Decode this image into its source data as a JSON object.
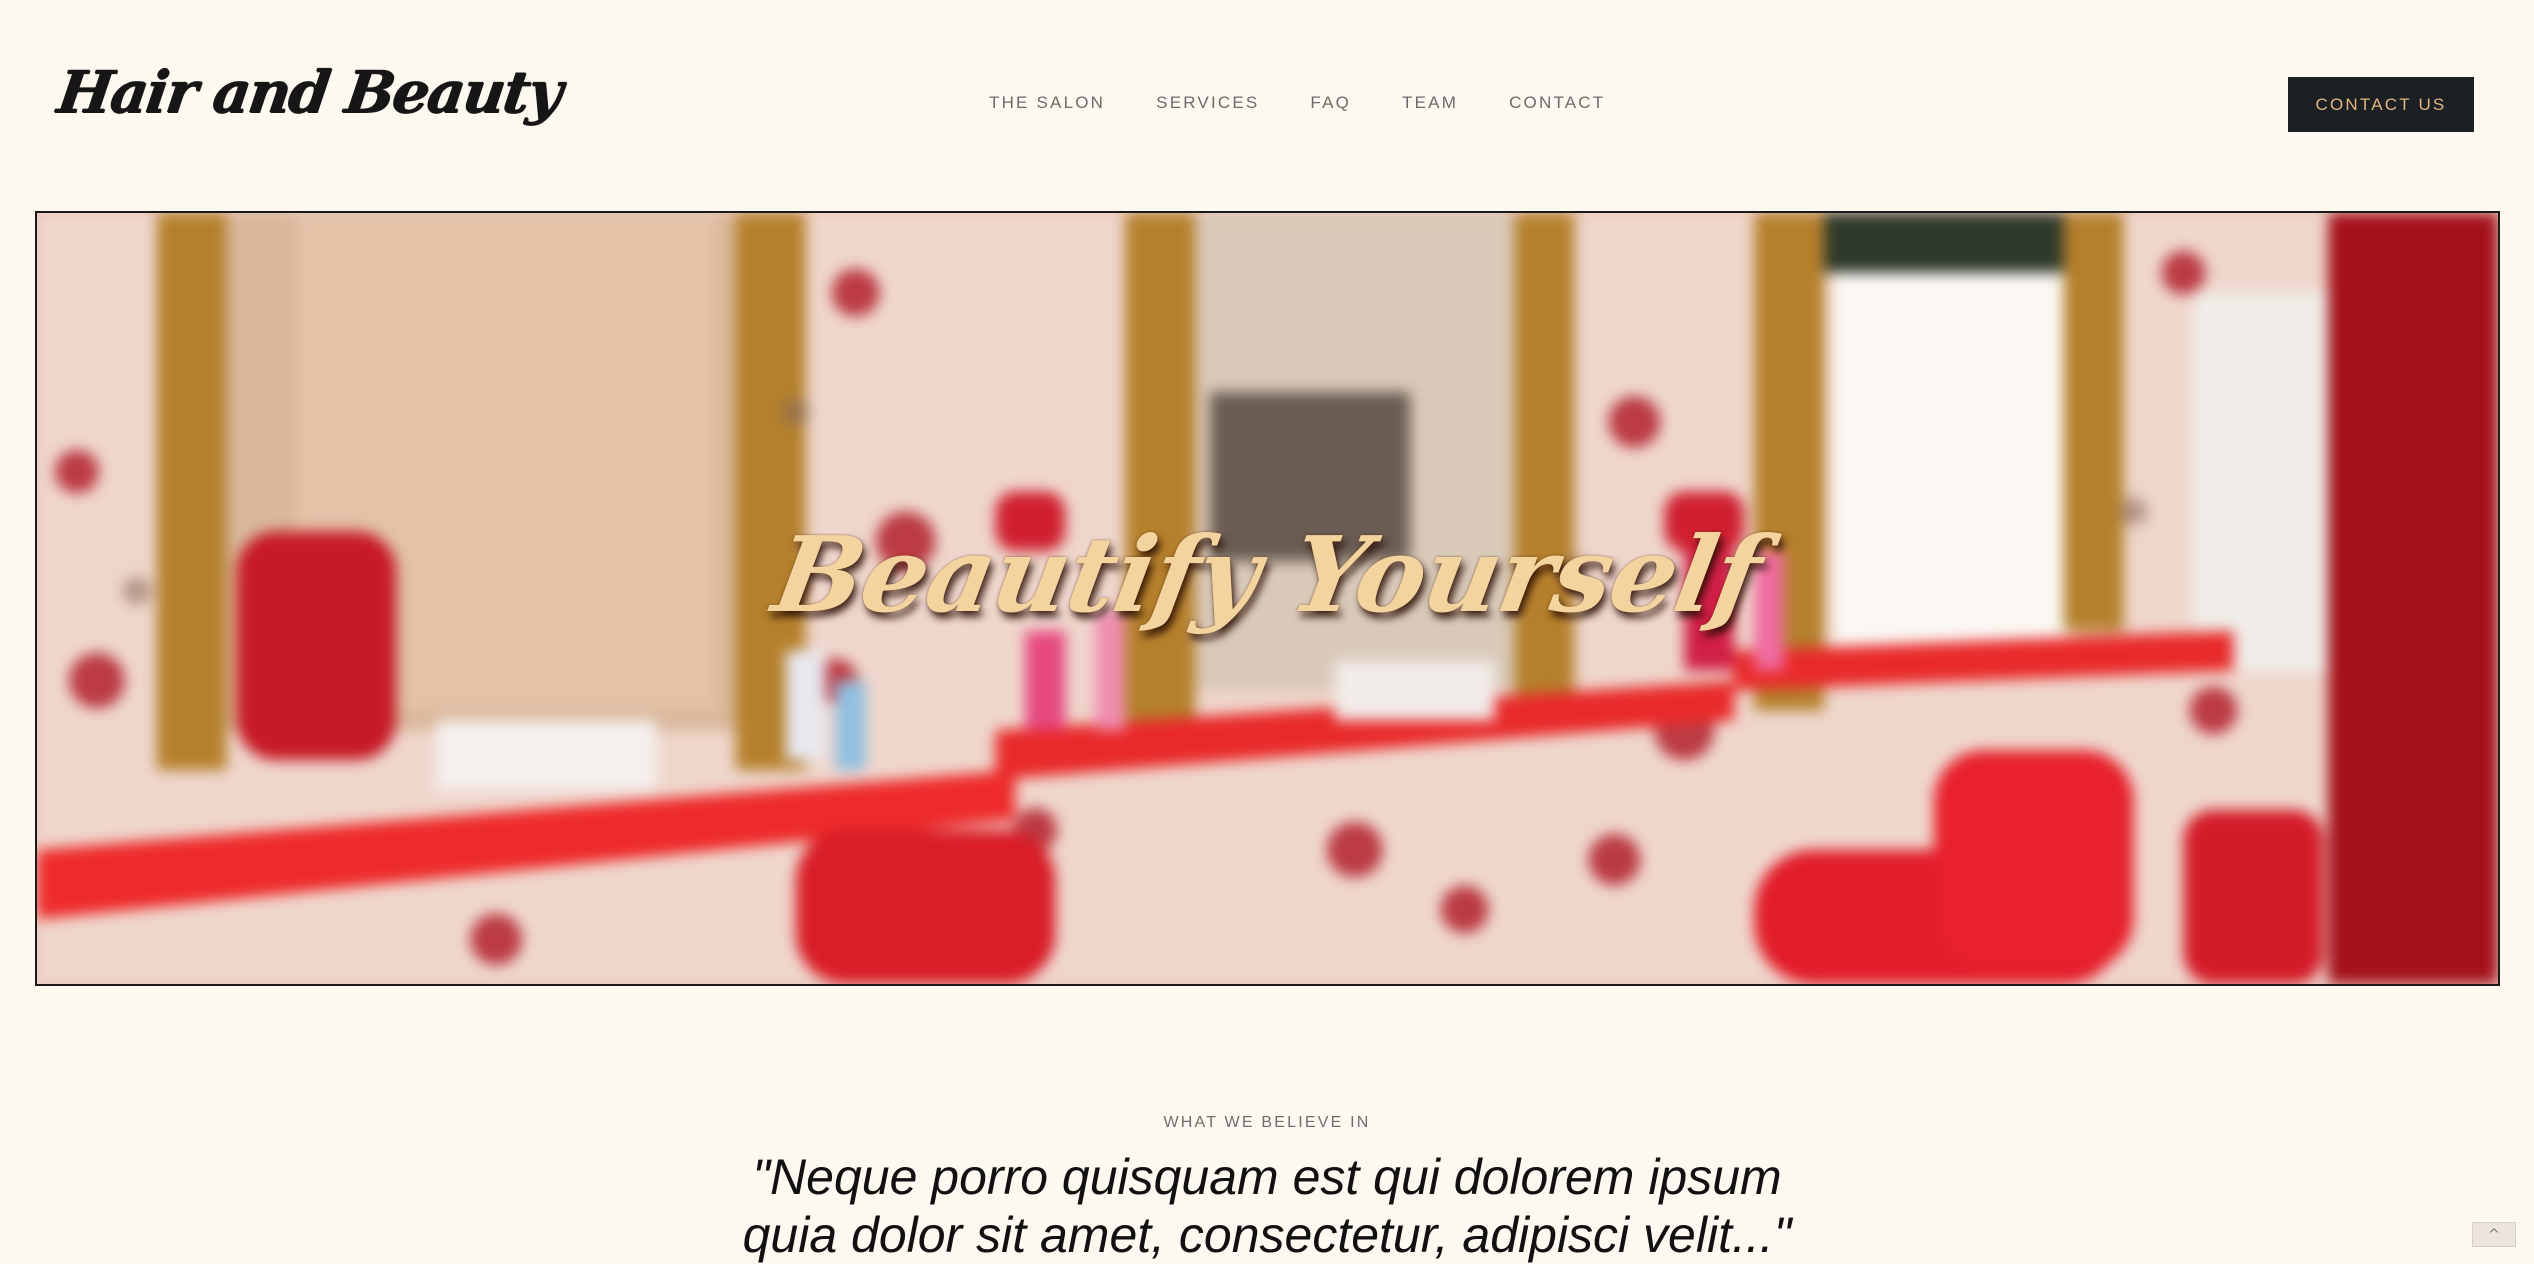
{
  "header": {
    "logo_text": "Hair and Beauty",
    "nav": [
      {
        "label": "THE SALON"
      },
      {
        "label": "SERVICES"
      },
      {
        "label": "FAQ"
      },
      {
        "label": "TEAM"
      },
      {
        "label": "CONTACT"
      }
    ],
    "cta_label": "CONTACT US"
  },
  "hero": {
    "title": "Beautify Yourself",
    "image_description_icon": "salon-interior-image"
  },
  "belief": {
    "label": "WHAT WE BELIEVE IN",
    "quote": "\"Neque porro quisquam est qui dolorem ipsum quia dolor sit amet, consectetur, adipisci velit...\""
  },
  "scroll_top": {
    "icon": "chevron-up-icon",
    "glyph": "^"
  },
  "colors": {
    "background": "#fdf8f0",
    "cta_background": "#1c1f24",
    "cta_text": "#e2b77e",
    "hero_title": "#f3d39e",
    "accent_red": "#e3222b"
  }
}
